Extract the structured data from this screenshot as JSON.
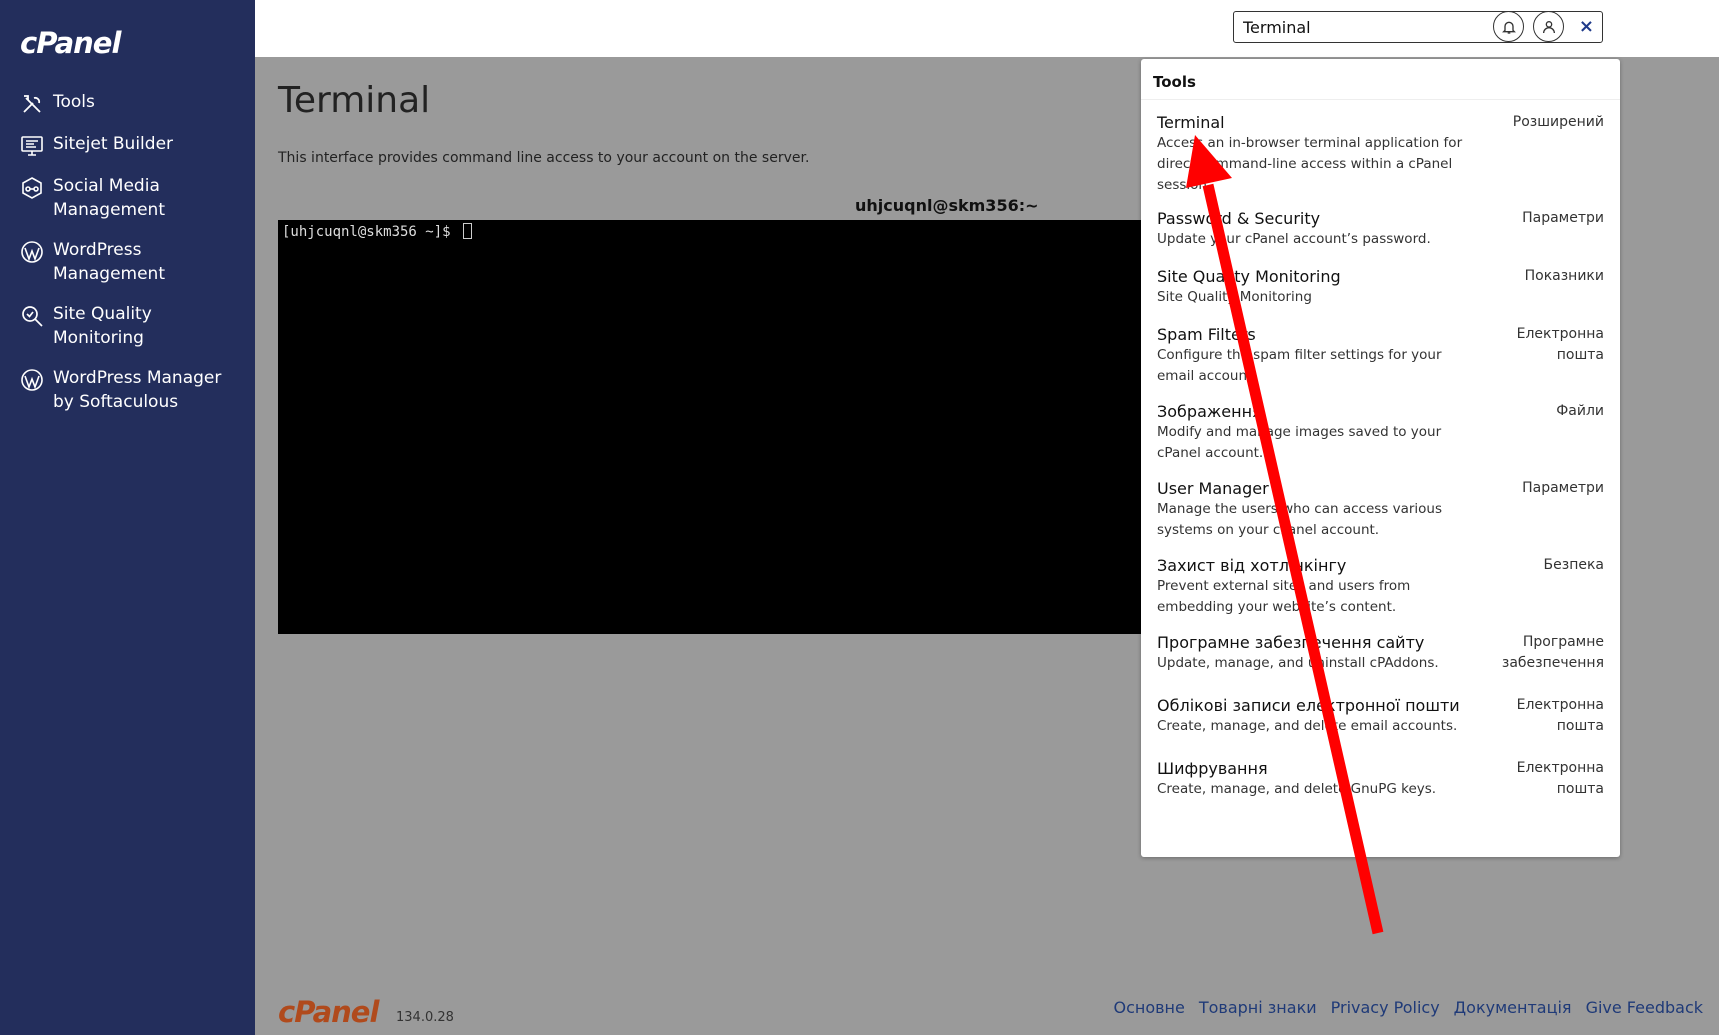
{
  "app": {
    "logo": "cPanel"
  },
  "sidebar": {
    "items": [
      {
        "label": "Tools",
        "icon": "tools-icon"
      },
      {
        "label": "Sitejet Builder",
        "icon": "monitor-icon"
      },
      {
        "label": "Social Media\nManagement",
        "icon": "social-icon"
      },
      {
        "label": "WordPress\nManagement",
        "icon": "wordpress-icon"
      },
      {
        "label": "Site Quality\nMonitoring",
        "icon": "magnifier-check-icon"
      },
      {
        "label": "WordPress Manager\nby Softaculous",
        "icon": "wordpress-icon"
      }
    ]
  },
  "topbar": {
    "search_value": "Terminal",
    "clear_glyph": "×",
    "icons": [
      "bell-icon",
      "user-icon"
    ]
  },
  "main": {
    "title": "Terminal",
    "description": "This interface provides command line access to your account on the server.",
    "terminal_title": "uhjcuqnl@skm356:~",
    "terminal_prompt": "[uhjcuqnl@skm356 ~]$ "
  },
  "dropdown": {
    "header": "Tools",
    "items": [
      {
        "title": "Terminal",
        "desc": "Access an in-browser terminal application for direct command-line access within a cPanel session.",
        "category": "Розширений"
      },
      {
        "title": "Password & Security",
        "desc": "Update your cPanel account’s password.",
        "category": "Параметри"
      },
      {
        "title": "Site Quality Monitoring",
        "desc": "Site Quality Monitoring",
        "category": "Показники"
      },
      {
        "title": "Spam Filters",
        "desc": "Configure the spam filter settings for your email account.",
        "category": "Електронна пошта"
      },
      {
        "title": "Зображення",
        "desc": "Modify and manage images saved to your cPanel account.",
        "category": "Файли"
      },
      {
        "title": "User Manager",
        "desc": "Manage the users who can access various systems on your cPanel account.",
        "category": "Параметри"
      },
      {
        "title": "Захист від хотлінкінгу",
        "desc": "Prevent external sites and users from embedding your website’s content.",
        "category": "Безпека"
      },
      {
        "title": "Програмне забезпечення сайту",
        "desc": "Update, manage, and uninstall cPAddons.",
        "category": "Програмне забезпечення"
      },
      {
        "title": "Облікові записи електронної пошти",
        "desc": "Create, manage, and delete email accounts.",
        "category": "Електронна пошта"
      },
      {
        "title": "Шифрування",
        "desc": "Create, manage, and delete GnuPG keys.",
        "category": "Електронна пошта"
      }
    ]
  },
  "footer": {
    "logo": "cPanel",
    "version": "134.0.28",
    "links": [
      "Основне",
      "Товарні знаки",
      "Privacy Policy",
      "Документація",
      "Give Feedback"
    ]
  },
  "colors": {
    "sidebar": "#232e5c",
    "overlay": "#9a9a9a",
    "arrow": "#ff0000",
    "link": "#1f3a78"
  }
}
